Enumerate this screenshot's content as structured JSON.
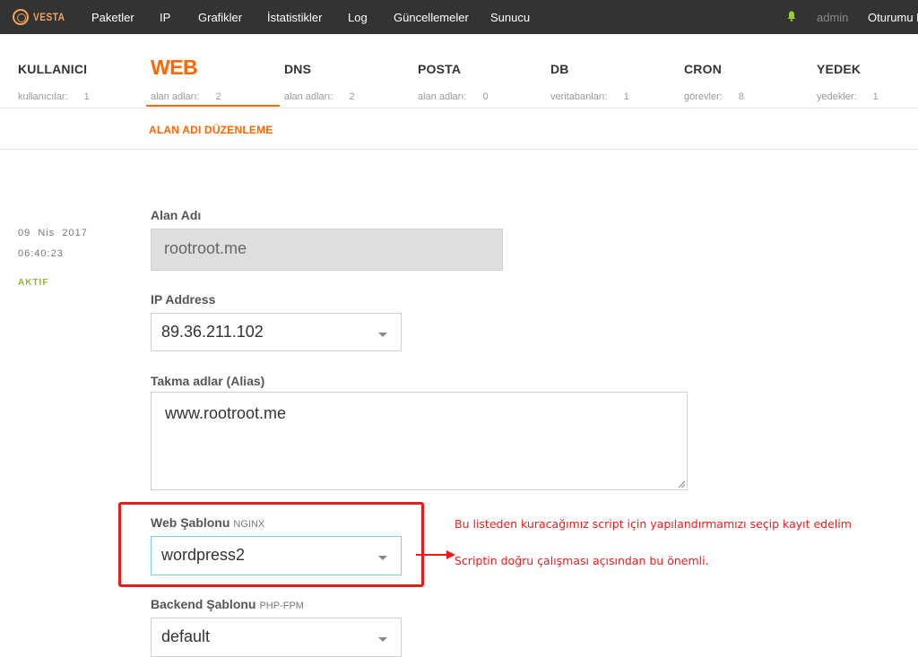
{
  "topbar": {
    "logo_text": "VESTA",
    "nav": [
      "Paketler",
      "IP",
      "Grafikler",
      "İstatistikler",
      "Log",
      "Güncellemeler",
      "Sunucu"
    ],
    "user": "admin",
    "logout": "Oturumu K"
  },
  "tabs": [
    {
      "title": "KULLANICI",
      "sub_label": "kullanıcılar:",
      "count": "1"
    },
    {
      "title": "WEB",
      "sub_label": "alan adları:",
      "count": "2"
    },
    {
      "title": "DNS",
      "sub_label": "alan adları:",
      "count": "2"
    },
    {
      "title": "POSTA",
      "sub_label": "alan adları:",
      "count": "0"
    },
    {
      "title": "DB",
      "sub_label": "veritabanları:",
      "count": "1"
    },
    {
      "title": "CRON",
      "sub_label": "görevler:",
      "count": "8"
    },
    {
      "title": "YEDEK",
      "sub_label": "yedekler:",
      "count": "1"
    }
  ],
  "breadcrumb": "ALAN ADI DÜZENLEME",
  "meta": {
    "date": "09  Nis  2017",
    "time": "06:40:23",
    "status": "AKTIF"
  },
  "form": {
    "domain_label": "Alan Adı",
    "domain_value": "rootroot.me",
    "ip_label": "IP Address",
    "ip_value": "89.36.211.102",
    "alias_label": "Takma adlar (Alias)",
    "alias_value": "www.rootroot.me",
    "web_template_label": "Web Şablonu",
    "web_template_hint": "NGINX",
    "web_template_value": "wordpress2",
    "backend_template_label": "Backend Şablonu",
    "backend_template_hint": "PHP-FPM",
    "backend_template_value": "default"
  },
  "annotation": {
    "line1": "Bu listeden kuracağımız script için yapılandırmamızı seçip kayıt edelim",
    "line2": "Scriptin doğru çalışması açısından bu önemli."
  },
  "colors": {
    "accent": "#ff6600",
    "topbar": "#333333",
    "status": "#8bb83a",
    "annotation": "#e81c1c"
  }
}
